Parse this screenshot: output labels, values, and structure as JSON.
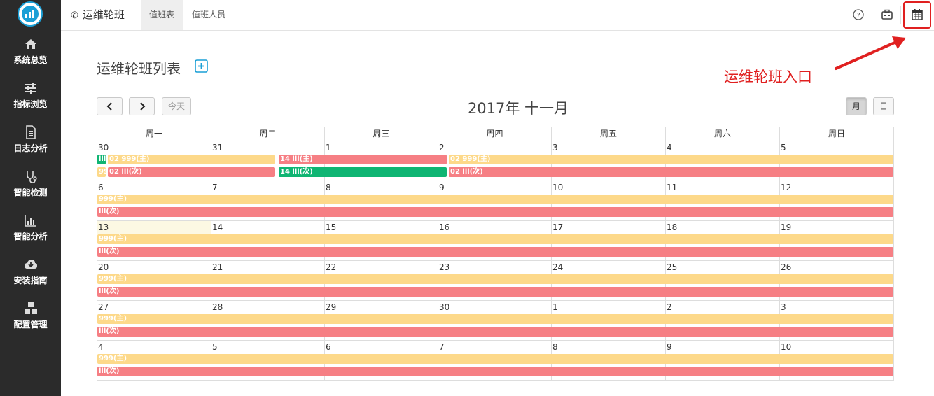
{
  "sidebar": {
    "items": [
      {
        "label": "系统总览",
        "icon": "home-icon"
      },
      {
        "label": "指标浏览",
        "icon": "sliders-icon"
      },
      {
        "label": "日志分析",
        "icon": "document-icon"
      },
      {
        "label": "智能检测",
        "icon": "stethoscope-icon"
      },
      {
        "label": "智能分析",
        "icon": "bar-chart-icon"
      },
      {
        "label": "安装指南",
        "icon": "cloud-download-icon"
      },
      {
        "label": "配置管理",
        "icon": "cubes-icon"
      }
    ]
  },
  "topbar": {
    "brand": "运维轮班",
    "tabs": [
      "值班表",
      "值班人员"
    ]
  },
  "page": {
    "title": "运维轮班列表",
    "annotation": "运维轮班入口"
  },
  "calendar": {
    "title": "2017年 十一月",
    "today_label": "今天",
    "view_month": "月",
    "view_day": "日",
    "weekdays": [
      "周一",
      "周二",
      "周三",
      "周四",
      "周五",
      "周六",
      "周日"
    ],
    "weeks": [
      [
        "30",
        "31",
        "1",
        "2",
        "3",
        "4",
        "5"
      ],
      [
        "6",
        "7",
        "8",
        "9",
        "10",
        "11",
        "12"
      ],
      [
        "13",
        "14",
        "15",
        "16",
        "17",
        "18",
        "19"
      ],
      [
        "20",
        "21",
        "22",
        "23",
        "24",
        "25",
        "26"
      ],
      [
        "27",
        "28",
        "29",
        "30",
        "1",
        "2",
        "3"
      ],
      [
        "4",
        "5",
        "6",
        "7",
        "8",
        "9",
        "10"
      ]
    ],
    "events": {
      "w0": [
        "lll(",
        "02 999(主)",
        "14 lll(主)",
        "02 999(主)",
        "99",
        "02 lll(次)",
        "14 lll(次)",
        "02 lll(次)"
      ],
      "main": "999(主)",
      "second": "lll(次)"
    }
  },
  "colors": {
    "sidebar_bg": "#2b2b2b",
    "accent": "#1a9fd6",
    "event_yellow": "#fdd98a",
    "event_red": "#f67f84",
    "event_green": "#0fb573",
    "annotation_red": "#e02020"
  }
}
